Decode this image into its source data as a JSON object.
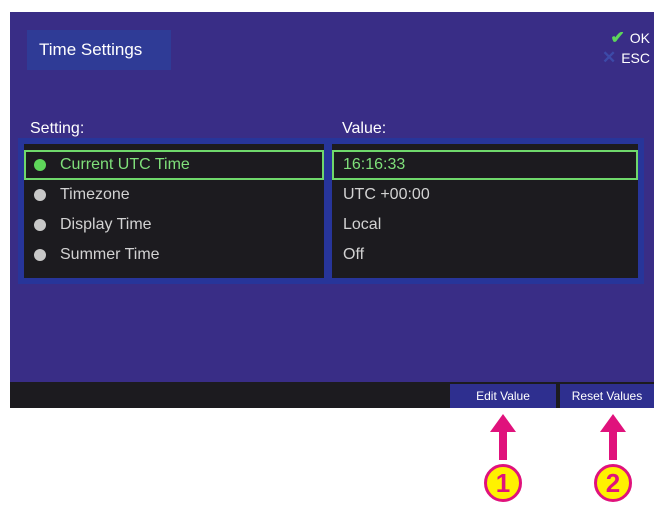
{
  "screen": {
    "title": "Time Settings",
    "hints": {
      "ok_label": "OK",
      "esc_label": "ESC",
      "ok_icon": "checkmark-icon",
      "esc_icon": "cross-icon"
    },
    "table": {
      "setting_header": "Setting:",
      "value_header": "Value:",
      "rows": [
        {
          "setting": "Current UTC Time",
          "value": "16:16:33",
          "selected": true
        },
        {
          "setting": "Timezone",
          "value": "UTC +00:00",
          "selected": false
        },
        {
          "setting": "Display Time",
          "value": "Local",
          "selected": false
        },
        {
          "setting": "Summer Time",
          "value": "Off",
          "selected": false
        }
      ]
    },
    "softkeys": {
      "edit_label": "Edit Value",
      "reset_label": "Reset Values"
    }
  },
  "callouts": [
    "1",
    "2"
  ],
  "colors": {
    "screen_bg": "#392d86",
    "selected_green": "#6fd86b",
    "callout_fill": "#fff200",
    "callout_magenta": "#e0127c"
  }
}
